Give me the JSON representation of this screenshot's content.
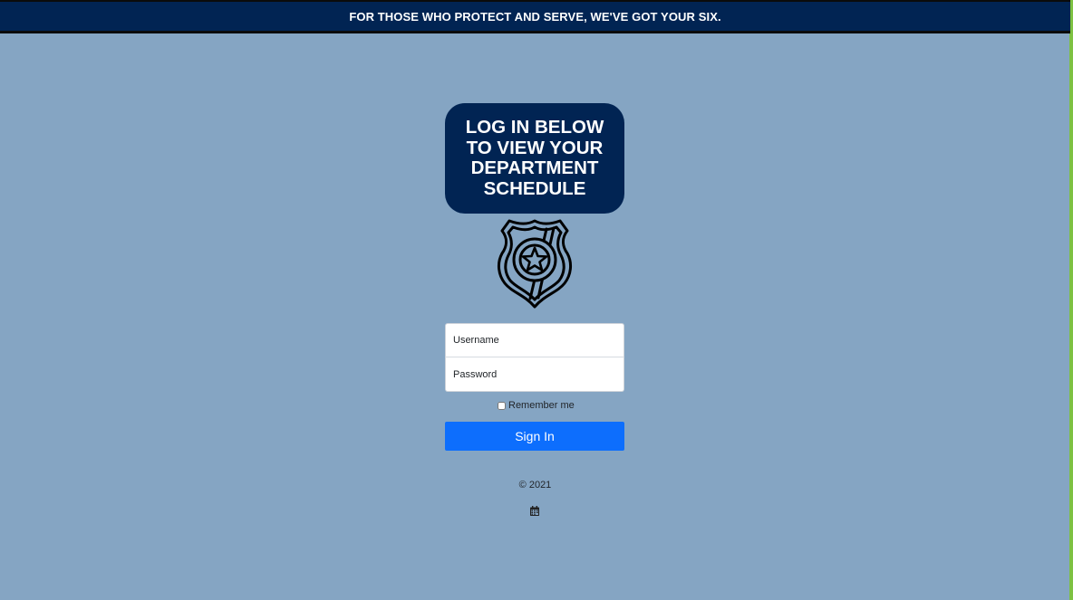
{
  "banner": {
    "text": "FOR THOSE WHO PROTECT AND SERVE, WE'VE GOT YOUR SIX."
  },
  "heading": {
    "text": "LOG IN BELOW TO VIEW YOUR DEPARTMENT SCHEDULE"
  },
  "logo": {
    "icon": "police-badge-icon"
  },
  "form": {
    "username_placeholder": "Username",
    "password_placeholder": "Password",
    "remember_label": "Remember me",
    "remember_checked": false,
    "signin_label": "Sign In"
  },
  "footer": {
    "copyright": "© 2021",
    "icon": "calendar-icon"
  },
  "colors": {
    "background": "#85a5c3",
    "navy": "#012453",
    "button": "#0d6efd",
    "edge_accent": "#7dc142"
  }
}
